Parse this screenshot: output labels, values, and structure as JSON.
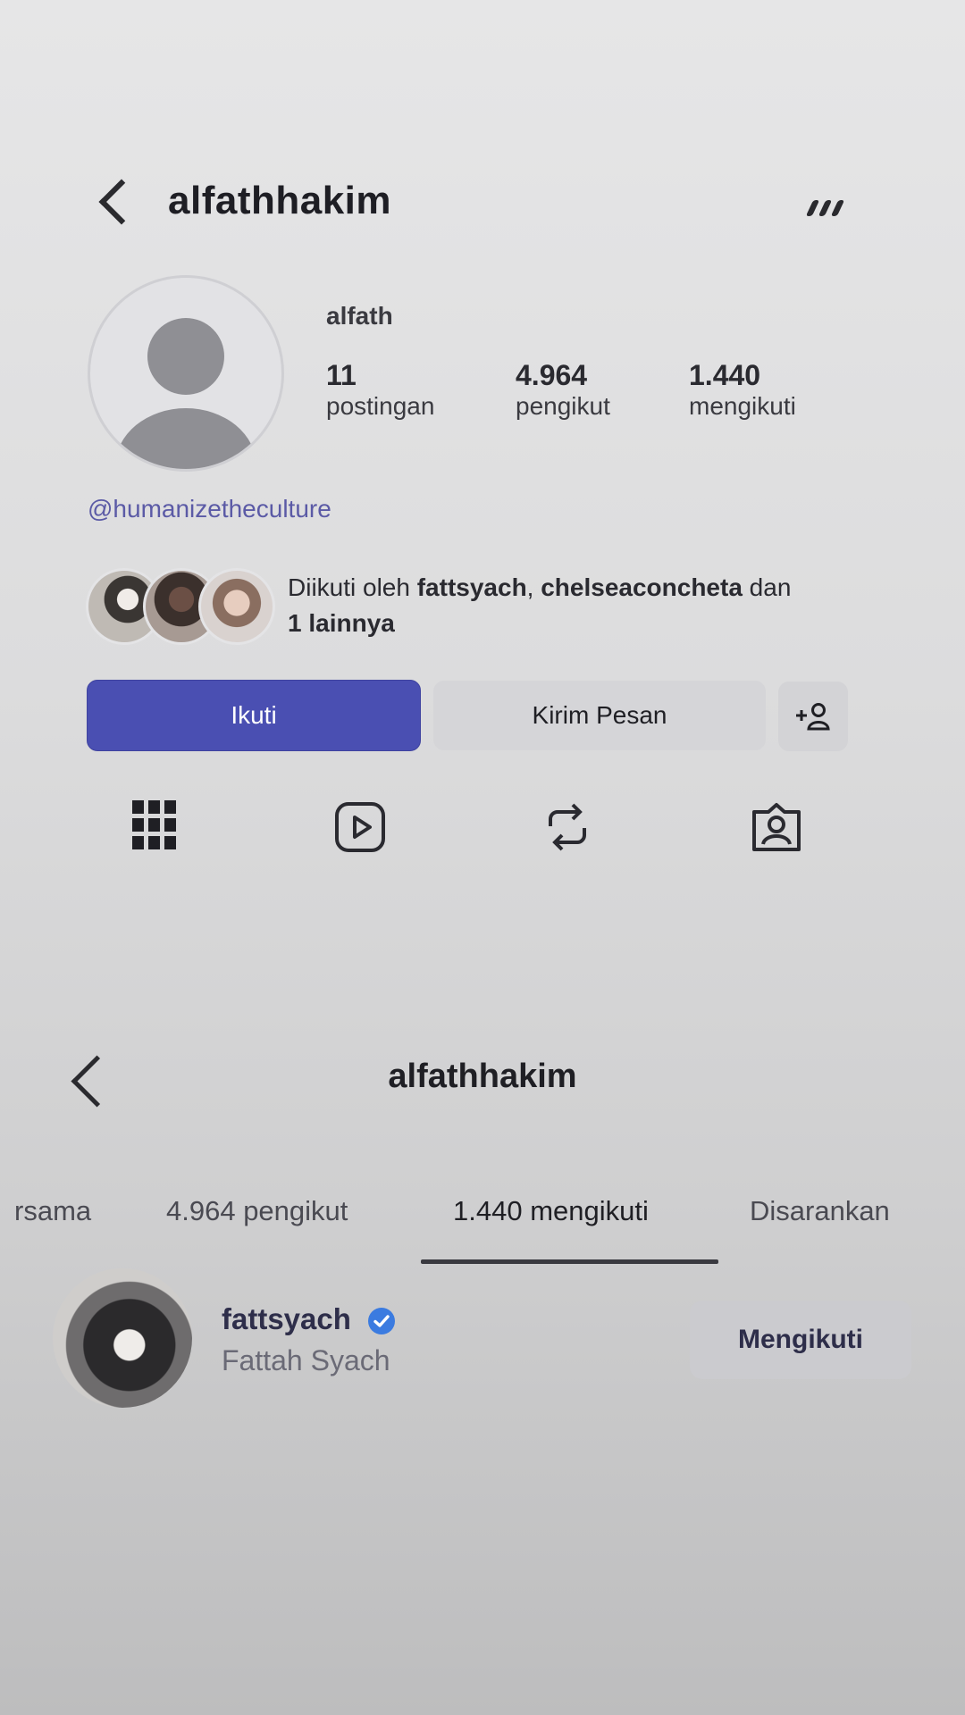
{
  "profile": {
    "username": "alfathhakim",
    "display_name": "alfath",
    "stats": [
      {
        "value": "11",
        "label": "postingan"
      },
      {
        "value": "4.964",
        "label": "pengikut"
      },
      {
        "value": "1.440",
        "label": "mengikuti"
      }
    ],
    "bio_handle": "@humanizetheculture",
    "followed_by": {
      "prefix": "Diikuti oleh ",
      "user1": "fattsyach",
      "separator": ", ",
      "user2": "chelseaconcheta",
      "joiner": " dan",
      "more": "1 lainnya"
    },
    "buttons": {
      "follow": "Ikuti",
      "message": "Kirim Pesan"
    },
    "tab_icons": [
      "grid-icon",
      "reels-icon",
      "reposts-icon",
      "tagged-icon"
    ]
  },
  "following_list": {
    "title": "alfathhakim",
    "tabs": [
      "rsama",
      "4.964 pengikut",
      "1.440 mengikuti",
      "Disarankan"
    ],
    "active_tab_index": 2,
    "users": [
      {
        "username": "fattsyach",
        "full_name": "Fattah Syach",
        "verified": true,
        "button": "Mengikuti"
      }
    ]
  },
  "colors": {
    "accent": "#4a4fb2",
    "verified": "#3b7be0",
    "handle": "#5b5aa6"
  }
}
